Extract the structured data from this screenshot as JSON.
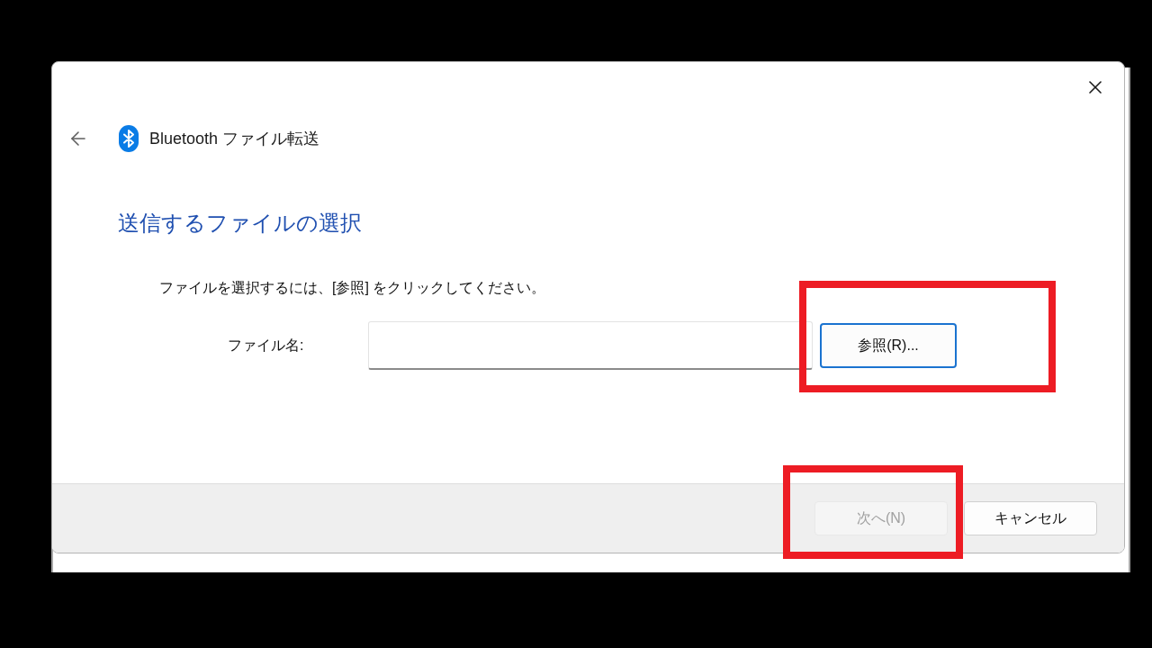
{
  "window": {
    "title": "Bluetooth ファイル転送"
  },
  "heading": "送信するファイルの選択",
  "instruction": "ファイルを選択するには、[参照] をクリックしてください。",
  "file_name_field": {
    "label": "ファイル名:"
  },
  "browse_button": {
    "label": "参照(R)...",
    "focused": true
  },
  "buttons": [
    {
      "label": "次へ(N)",
      "disabled": true
    },
    {
      "label": "キャンセル",
      "disabled": false
    }
  ]
}
